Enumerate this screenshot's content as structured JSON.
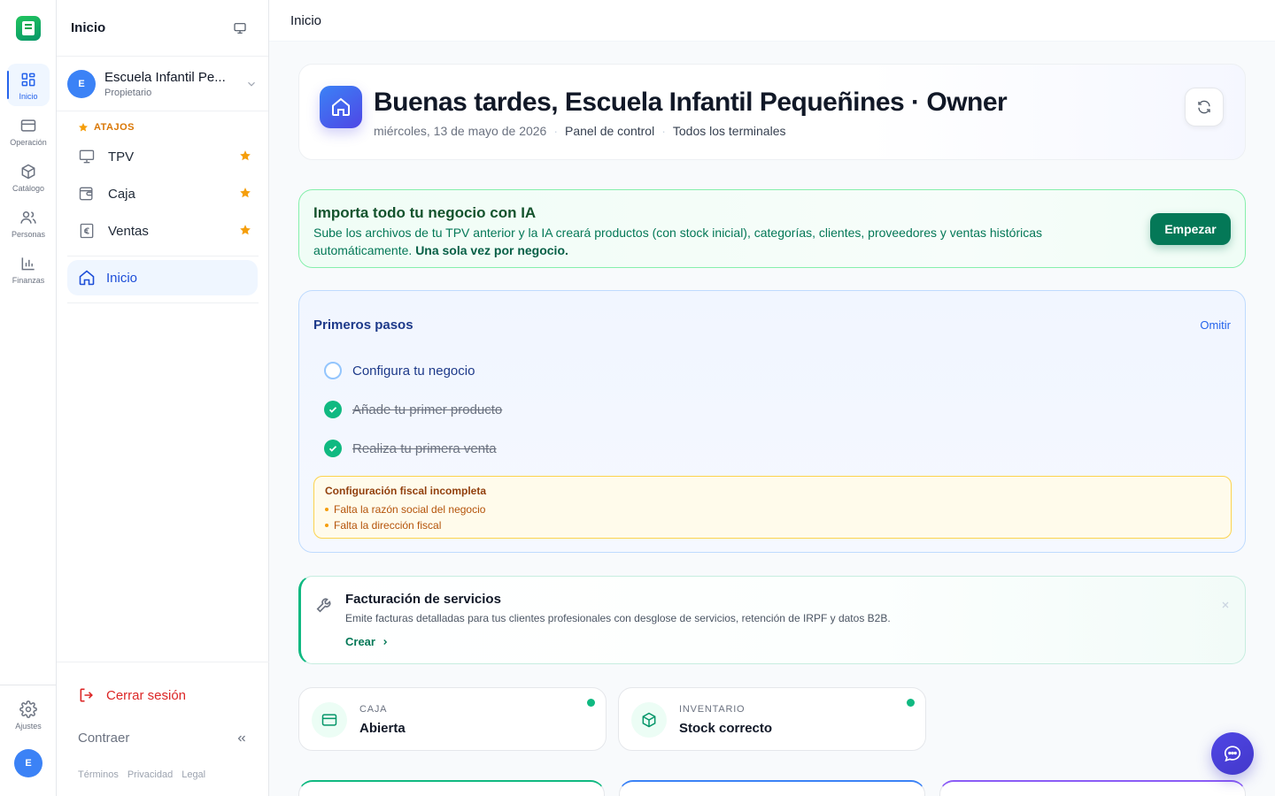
{
  "rail": {
    "items": [
      {
        "label": "Inicio",
        "icon": "grid-icon"
      },
      {
        "label": "Operación",
        "icon": "card-icon"
      },
      {
        "label": "Catálogo",
        "icon": "box-icon"
      },
      {
        "label": "Personas",
        "icon": "users-icon"
      },
      {
        "label": "Finanzas",
        "icon": "chart-icon"
      }
    ],
    "settings_label": "Ajustes",
    "avatar_initial": "E"
  },
  "panel": {
    "title": "Inicio",
    "org": {
      "initial": "E",
      "name": "Escuela Infantil Pe...",
      "role": "Propietario"
    },
    "shortcuts_label": "ATAJOS",
    "shortcuts": [
      {
        "label": "TPV",
        "icon": "monitor-icon"
      },
      {
        "label": "Caja",
        "icon": "wallet-icon"
      },
      {
        "label": "Ventas",
        "icon": "euro-receipt-icon"
      }
    ],
    "nav_active": "Inicio",
    "logout": "Cerrar sesión",
    "collapse": "Contraer",
    "legal": [
      "Términos",
      "Privacidad",
      "Legal"
    ]
  },
  "topbar": {
    "title": "Inicio"
  },
  "greeting": {
    "title": "Buenas tardes, Escuela Infantil Pequeñines · Owner",
    "date": "miércoles, 13 de mayo de 2026",
    "context": "Panel de control",
    "terminals": "Todos los terminales"
  },
  "ia_banner": {
    "title": "Importa todo tu negocio con IA",
    "text": "Sube los archivos de tu TPV anterior y la IA creará productos (con stock inicial), categorías, clientes, proveedores y ventas históricas automáticamente.",
    "emphasis": "Una sola vez por negocio.",
    "button": "Empezar"
  },
  "steps": {
    "title": "Primeros pasos",
    "skip": "Omitir",
    "items": [
      {
        "label": "Configura tu negocio",
        "done": false
      },
      {
        "label": "Añade tu primer producto",
        "done": true
      },
      {
        "label": "Realiza tu primera venta",
        "done": true
      }
    ],
    "warning": {
      "title": "Configuración fiscal incompleta",
      "items": [
        "Falta la razón social del negocio",
        "Falta la dirección fiscal"
      ]
    }
  },
  "feature": {
    "title": "Facturación de servicios",
    "text": "Emite facturas detalladas para tus clientes profesionales con desglose de servicios, retención de IRPF y datos B2B.",
    "link": "Crear"
  },
  "stats": [
    {
      "label": "CAJA",
      "value": "Abierta",
      "icon": "card-icon",
      "status_color": "#10b981"
    },
    {
      "label": "INVENTARIO",
      "value": "Stock correcto",
      "icon": "box-icon",
      "status_color": "#10b981"
    }
  ],
  "colors": {
    "accent": "#2563eb",
    "success": "#047857",
    "warning": "#d97706",
    "danger": "#dc2626"
  }
}
